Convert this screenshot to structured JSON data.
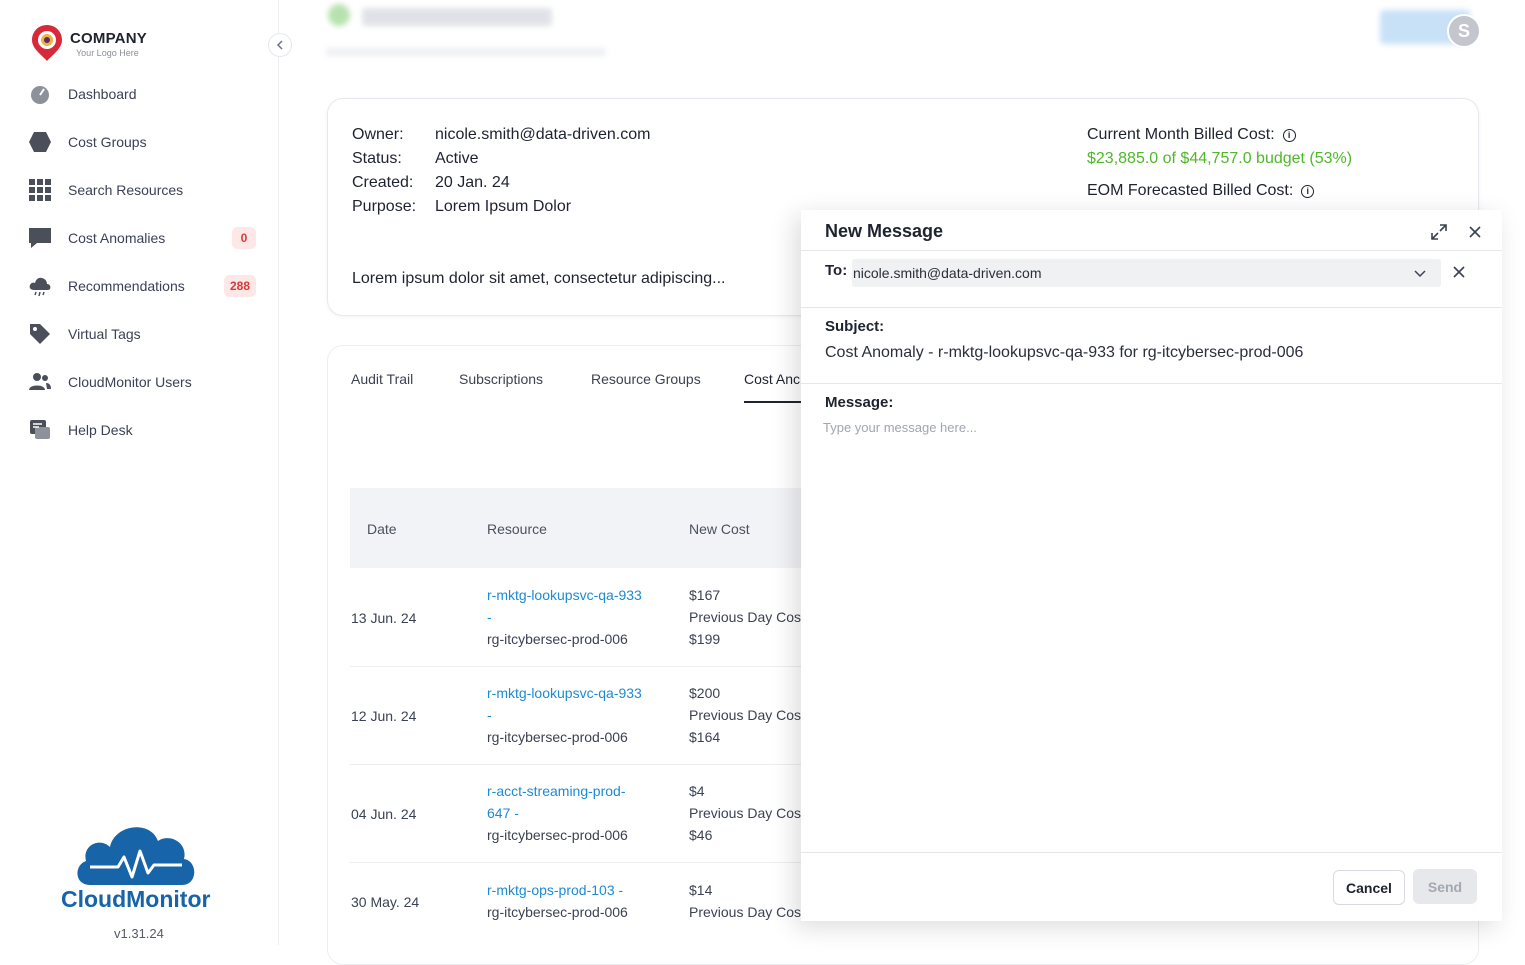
{
  "sidebar": {
    "brand": "COMPANY",
    "tagline": "Your Logo Here",
    "items": [
      {
        "label": "Dashboard",
        "icon": "dashboard-icon",
        "badge": ""
      },
      {
        "label": "Cost Groups",
        "icon": "hexagon-icon",
        "badge": ""
      },
      {
        "label": "Search Resources",
        "icon": "grid-icon",
        "badge": ""
      },
      {
        "label": "Cost Anomalies",
        "icon": "chat-icon",
        "badge": "0"
      },
      {
        "label": "Recommendations",
        "icon": "cloud-icon",
        "badge": "288"
      },
      {
        "label": "Virtual Tags",
        "icon": "tag-icon",
        "badge": ""
      },
      {
        "label": "CloudMonitor Users",
        "icon": "users-icon",
        "badge": ""
      },
      {
        "label": "Help Desk",
        "icon": "helpdesk-icon",
        "badge": ""
      }
    ],
    "product_name": "CloudMonitor",
    "version": "v1.31.24"
  },
  "header": {
    "avatar_initial": "S"
  },
  "info": {
    "owner_label": "Owner:",
    "owner": "nicole.smith@data-driven.com",
    "status_label": "Status:",
    "status": "Active",
    "created_label": "Created:",
    "created": "20 Jan. 24",
    "purpose_label": "Purpose:",
    "purpose": "Lorem Ipsum Dolor",
    "description": "Lorem ipsum dolor sit amet, consectetur adipiscing...",
    "current_cost_label": "Current Month Billed Cost:",
    "current_cost_value": "$23,885.0 of $44,757.0 budget (53%)",
    "eom_label": "EOM Forecasted Billed Cost:"
  },
  "tabs": [
    "Audit Trail",
    "Subscriptions",
    "Resource Groups",
    "Cost Anc"
  ],
  "table": {
    "headers": [
      "Date",
      "Resource",
      "New Cost"
    ],
    "rows": [
      {
        "date": "13 Jun. 24",
        "resource_link": "r-mktg-lookupsvc-qa-933",
        "resource_link2": "-",
        "resource_group": "rg-itcybersec-prod-006",
        "new_cost": "$167",
        "prev_label": "Previous Day Cos",
        "prev_cost": "$199"
      },
      {
        "date": "12 Jun. 24",
        "resource_link": "r-mktg-lookupsvc-qa-933",
        "resource_link2": "-",
        "resource_group": "rg-itcybersec-prod-006",
        "new_cost": "$200",
        "prev_label": "Previous Day Cos",
        "prev_cost": "$164"
      },
      {
        "date": "04 Jun. 24",
        "resource_link": "r-acct-streaming-prod-",
        "resource_link2": "647 -",
        "resource_group": "rg-itcybersec-prod-006",
        "new_cost": "$4",
        "prev_label": "Previous Day Cos",
        "prev_cost": "$46"
      },
      {
        "date": "30 May. 24",
        "resource_link": "r-mktg-ops-prod-103 -",
        "resource_link2": "",
        "resource_group": "rg-itcybersec-prod-006",
        "new_cost": "$14",
        "prev_label": "Previous Day Cos",
        "prev_cost": ""
      }
    ]
  },
  "modal": {
    "title": "New Message",
    "to_label": "To:",
    "to_value": "nicole.smith@data-driven.com",
    "subject_label": "Subject:",
    "subject_value": "Cost Anomaly - r-mktg-lookupsvc-qa-933 for rg-itcybersec-prod-006",
    "message_label": "Message:",
    "message_placeholder": "Type your message here...",
    "cancel_label": "Cancel",
    "send_label": "Send"
  },
  "colors": {
    "accent_blue": "#1c8ad6",
    "budget_green": "#4fb82a",
    "badge_red": "#d63b3b",
    "brand_blue": "#1764a8"
  }
}
